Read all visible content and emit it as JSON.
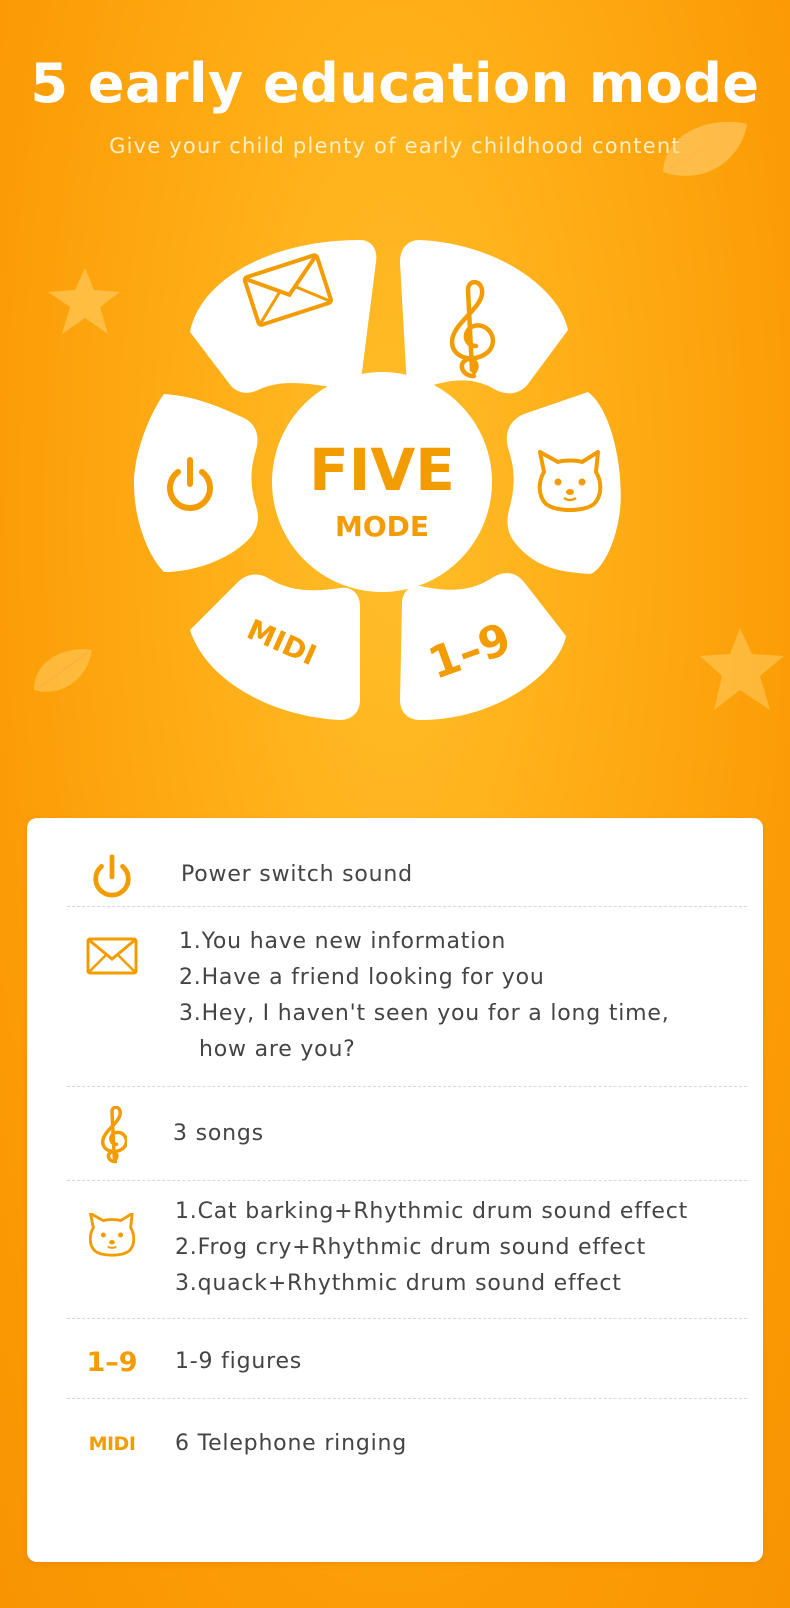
{
  "header": {
    "title": "5 early education mode",
    "subtitle": "Give your child plenty of early childhood content"
  },
  "wheel": {
    "center_line1": "FIVE",
    "center_line2": "MODE",
    "segments": [
      {
        "icon": "envelope-icon"
      },
      {
        "icon": "treble-clef-icon"
      },
      {
        "icon": "cat-face-icon"
      },
      {
        "icon": "numbers-icon",
        "label": "1–9"
      },
      {
        "icon": "midi-icon",
        "label": "MIDI"
      },
      {
        "icon": "power-icon"
      }
    ]
  },
  "features": [
    {
      "icon": "power-icon",
      "lines": [
        "Power switch sound"
      ]
    },
    {
      "icon": "envelope-icon",
      "lines": [
        "1.You have new information",
        "2.Have a friend looking for you",
        "3.Hey, I haven't seen you for a long time,",
        "how are you?"
      ]
    },
    {
      "icon": "treble-clef-icon",
      "lines": [
        "3 songs"
      ]
    },
    {
      "icon": "cat-face-icon",
      "lines": [
        "1.Cat barking+Rhythmic drum sound effect",
        "2.Frog cry+Rhythmic drum sound effect",
        "3.quack+Rhythmic drum sound effect"
      ]
    },
    {
      "icon": "numbers-icon",
      "icon_label": "1–9",
      "lines": [
        "1-9 figures"
      ]
    },
    {
      "icon": "midi-icon",
      "icon_label": "MIDI",
      "lines": [
        "6 Telephone ringing"
      ]
    }
  ],
  "colors": {
    "accent": "#f39c00",
    "background": "#ffac15",
    "card": "#ffffff",
    "text": "#444444"
  }
}
